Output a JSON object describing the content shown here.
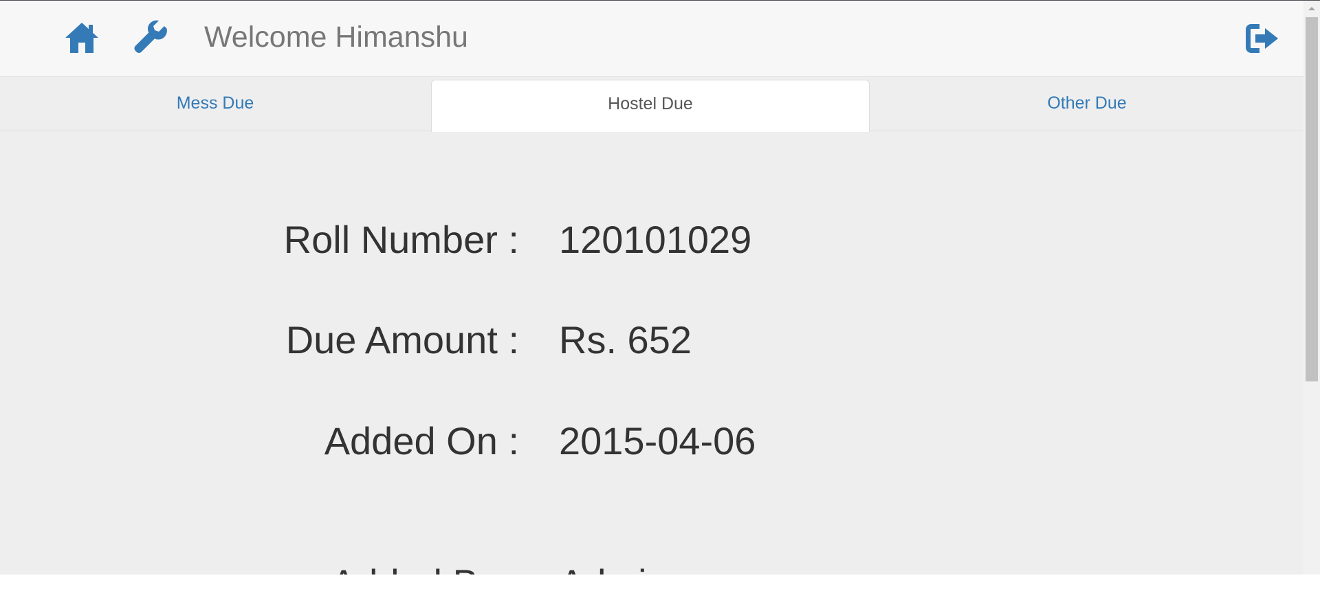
{
  "header": {
    "welcome_text": "Welcome Himanshu",
    "icons": {
      "home": "home-icon",
      "settings": "wrench-icon",
      "logout": "logout-icon"
    },
    "accent_color": "#337ab7"
  },
  "tabs": [
    {
      "label": "Mess Due",
      "active": false
    },
    {
      "label": "Hostel Due",
      "active": true
    },
    {
      "label": "Other Due",
      "active": false
    }
  ],
  "details": {
    "roll_number": {
      "label": "Roll Number :",
      "value": "120101029"
    },
    "due_amount": {
      "label": "Due Amount :",
      "value": "Rs. 652"
    },
    "added_on": {
      "label": "Added On :",
      "value": "2015-04-06"
    },
    "added_by": {
      "label": "Added By :",
      "value": "Admin"
    }
  }
}
